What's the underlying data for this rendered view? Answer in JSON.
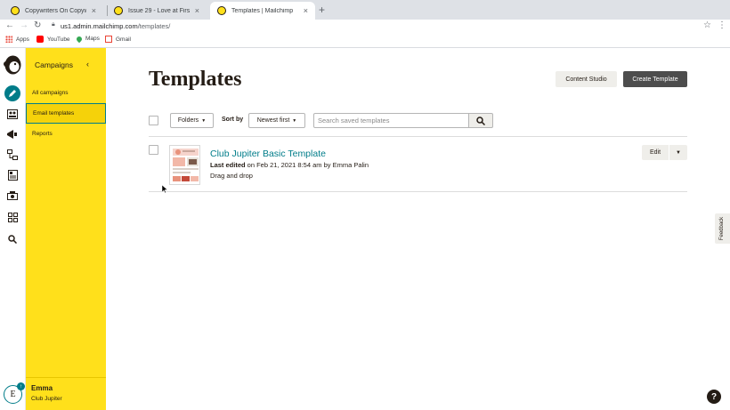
{
  "browser": {
    "tabs": [
      {
        "title": "Copywriters On Copywriting"
      },
      {
        "title": "Issue 29 - Love at First Write"
      },
      {
        "title": "Templates | Mailchimp"
      }
    ],
    "url_host": "us1.admin.mailchimp.com",
    "url_path": "/templates/",
    "bookmarks": [
      {
        "label": "Apps"
      },
      {
        "label": "YouTube"
      },
      {
        "label": "Maps"
      },
      {
        "label": "Gmail"
      }
    ]
  },
  "rail": {
    "avatar_initial": "E"
  },
  "sidebar": {
    "title": "Campaigns",
    "items": [
      {
        "label": "All campaigns"
      },
      {
        "label": "Email templates"
      },
      {
        "label": "Reports"
      }
    ],
    "user_name": "Emma",
    "user_org": "Club Jupiter"
  },
  "main": {
    "title": "Templates",
    "content_studio_label": "Content Studio",
    "create_template_label": "Create Template",
    "folders_label": "Folders",
    "sort_by_label": "Sort by",
    "sort_value": "Newest first",
    "search_placeholder": "Search saved templates",
    "templates": [
      {
        "name": "Club Jupiter Basic Template",
        "edited_prefix": "Last edited",
        "edited_rest": " on Feb 21, 2021 8:54 am by Emma Palin",
        "type": "Drag and drop",
        "edit_label": "Edit"
      }
    ]
  },
  "feedback_label": "Feedback",
  "help_label": "?",
  "colors": {
    "brand_yellow": "#ffe01b",
    "accent_teal": "#007c89",
    "dark": "#241c15"
  }
}
